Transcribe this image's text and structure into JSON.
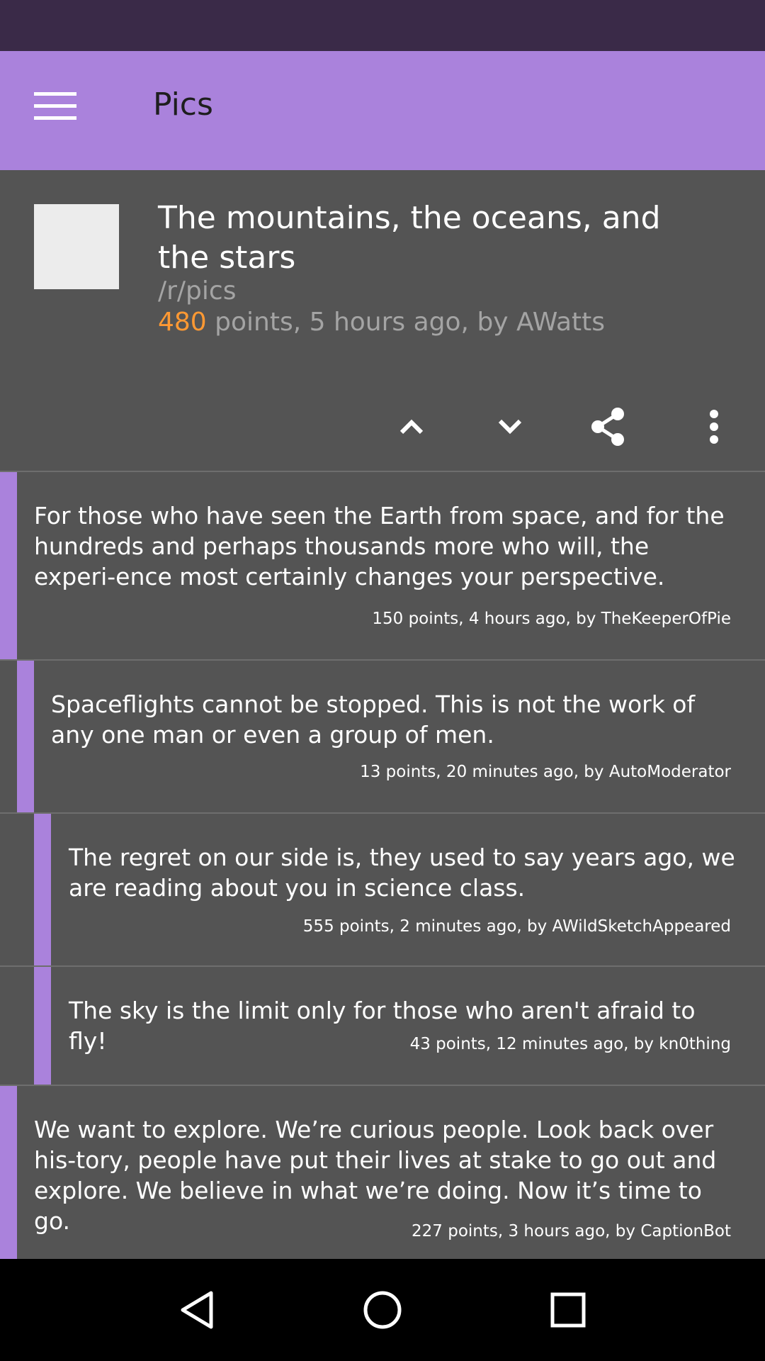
{
  "app": {
    "title": "Pics"
  },
  "post": {
    "title": "The mountains, the oceans, and the stars",
    "subreddit": "/r/pics",
    "points": "480",
    "meta_rest": " points, 5 hours ago, by AWatts"
  },
  "actions": [
    "upvote-icon",
    "downvote-icon",
    "share-icon",
    "more-vertical-icon"
  ],
  "comments": [
    {
      "body": "For those who have seen the Earth from space, and for the hundreds and perhaps thousands more who will, the experi-ence most certainly changes your perspective.",
      "meta": "150 points, 4 hours ago, by TheKeeperOfPie",
      "depth": 0
    },
    {
      "body": "Spaceflights cannot be stopped. This is not the work of any one man or even a group of men.",
      "meta": "13 points, 20 minutes ago, by AutoModerator",
      "depth": 1
    },
    {
      "body": "The regret on our side is, they used to say years ago, we are reading about you in science class.",
      "meta": "555 points, 2 minutes ago, by AWildSketchAppeared",
      "depth": 2
    },
    {
      "body": "The sky is the limit only for those who aren't afraid to fly!",
      "meta": "43 points, 12 minutes ago, by kn0thing",
      "depth": 2
    },
    {
      "body": "We want to explore. We’re curious people. Look back over his-tory, people have put their lives at stake to go out and explore. We believe in what we’re doing. Now it’s time to go.",
      "meta": "227 points, 3 hours ago, by CaptionBot",
      "depth": 0
    }
  ],
  "nav": [
    "back-icon",
    "home-icon",
    "recents-icon"
  ],
  "colors": {
    "accent": "#aa82dc",
    "points": "#ff9933",
    "status_bar": "#3a2a48",
    "background": "#545454"
  }
}
